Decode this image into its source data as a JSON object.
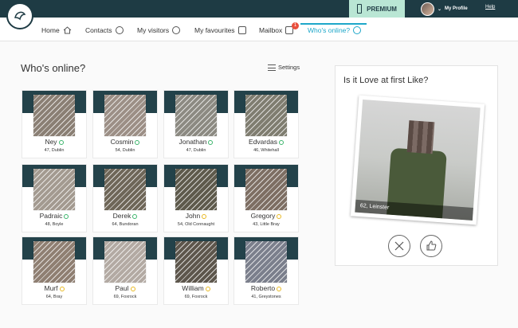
{
  "header": {
    "premium_label": "PREMIUM",
    "profile_label": "My Profile",
    "help_label": "Help"
  },
  "nav": {
    "items": [
      {
        "label": "Home",
        "icon": "home-icon"
      },
      {
        "label": "Contacts",
        "icon": "person-icon"
      },
      {
        "label": "My visitors",
        "icon": "eye-icon"
      },
      {
        "label": "My favourites",
        "icon": "book-icon"
      },
      {
        "label": "Mailbox",
        "icon": "mailbox-icon"
      },
      {
        "label": "Who's online?",
        "icon": "online-icon"
      }
    ],
    "active": "Who's online?",
    "mailbox_badge": "1"
  },
  "online": {
    "title": "Who's online?",
    "settings_label": "Settings",
    "members": [
      {
        "name": "Ney",
        "info": "47, Dublin",
        "status": "online",
        "photo": "#8a7f74"
      },
      {
        "name": "Cosmin",
        "info": "54, Dublin",
        "status": "online",
        "photo": "#9c8f86"
      },
      {
        "name": "Jonathan",
        "info": "47, Dublin",
        "status": "online",
        "photo": "#8c8a82"
      },
      {
        "name": "Edvardas",
        "info": "46, Whitehall",
        "status": "online",
        "photo": "#7f7d70"
      },
      {
        "name": "Padraic",
        "info": "48, Boyle",
        "status": "online",
        "photo": "#a39a90"
      },
      {
        "name": "Derek",
        "info": "64, Bundoran",
        "status": "online",
        "photo": "#6e6658"
      },
      {
        "name": "John",
        "info": "54, Old Connaught",
        "status": "away",
        "photo": "#5e5a4c"
      },
      {
        "name": "Gregory",
        "info": "43, Little Bray",
        "status": "away",
        "photo": "#7d6e63"
      },
      {
        "name": "Murf",
        "info": "64, Bray",
        "status": "away",
        "photo": "#8f7f72"
      },
      {
        "name": "Paul",
        "info": "69, Foxrock",
        "status": "away",
        "photo": "#b3aaa3"
      },
      {
        "name": "William",
        "info": "69, Foxrock",
        "status": "away",
        "photo": "#5d564c"
      },
      {
        "name": "Roberto",
        "info": "41, Greystones",
        "status": "away",
        "photo": "#7b7f8c"
      }
    ]
  },
  "love": {
    "title": "Is it Love at first Like?",
    "caption": "62, Leinster",
    "dislike_icon": "close-icon",
    "like_icon": "thumbs-up-icon"
  },
  "colors": {
    "accent": "#1ea7c9",
    "dark": "#1e3b44",
    "premium_bg": "#b9e6d4",
    "online": "#3bb56b",
    "away": "#e8b923"
  }
}
